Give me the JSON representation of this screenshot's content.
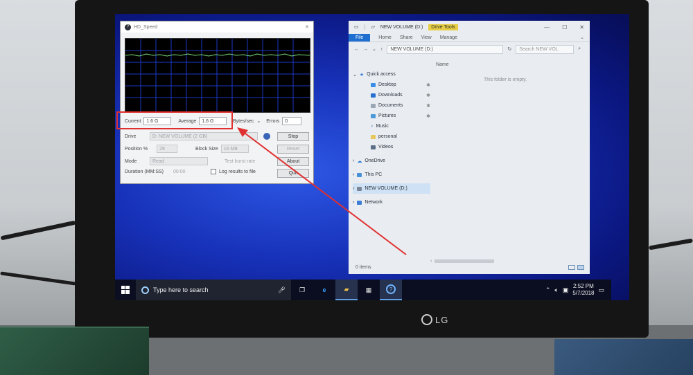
{
  "hdspeed": {
    "title": "HD_Speed",
    "current_label": "Current",
    "current_value": "1.6 G",
    "average_label": "Average",
    "average_value": "1.6 G",
    "unit_select": "Bytes/sec",
    "errors_label": "Errors",
    "errors_value": "0",
    "drive_label": "Drive",
    "drive_value": "D: NEW VOLUME (2 GB)",
    "stop_label": "Stop",
    "position_label": "Position %",
    "position_value": "29",
    "block_size_label": "Block Size",
    "block_size_value": "16 MB",
    "reset_label": "Reset",
    "mode_label": "Mode",
    "mode_value": "Read",
    "test_burst_label": "Test burst rate",
    "about_label": "About",
    "duration_label": "Duration (MM:SS)",
    "duration_value": "00:00",
    "log_label": "Log results to file",
    "quit_label": "Quit"
  },
  "explorer": {
    "title": "NEW VOLUME (D:)",
    "drive_tools": "Drive Tools",
    "ribbon": [
      "File",
      "Home",
      "Share",
      "View",
      "Manage"
    ],
    "path": "NEW VOLUME (D:)",
    "search_placeholder": "Search NEW VOL",
    "column_name": "Name",
    "empty_text": "This folder is empty.",
    "nav": [
      {
        "label": "Quick access"
      },
      {
        "label": "Desktop"
      },
      {
        "label": "Downloads"
      },
      {
        "label": "Documents"
      },
      {
        "label": "Pictures"
      },
      {
        "label": "Music"
      },
      {
        "label": "personal"
      },
      {
        "label": "Videos"
      },
      {
        "label": "OneDrive"
      },
      {
        "label": "This PC"
      },
      {
        "label": "NEW VOLUME (D:)"
      },
      {
        "label": "Network"
      }
    ],
    "status": "0 items"
  },
  "taskbar": {
    "search_placeholder": "Type here to search",
    "time": "2:52 PM",
    "date": "5/7/2018"
  },
  "monitor": {
    "brand": "LG"
  },
  "colors": {
    "accent": "#1f6fd0",
    "highlight": "#e03030",
    "graph_line": "#7de07d"
  }
}
